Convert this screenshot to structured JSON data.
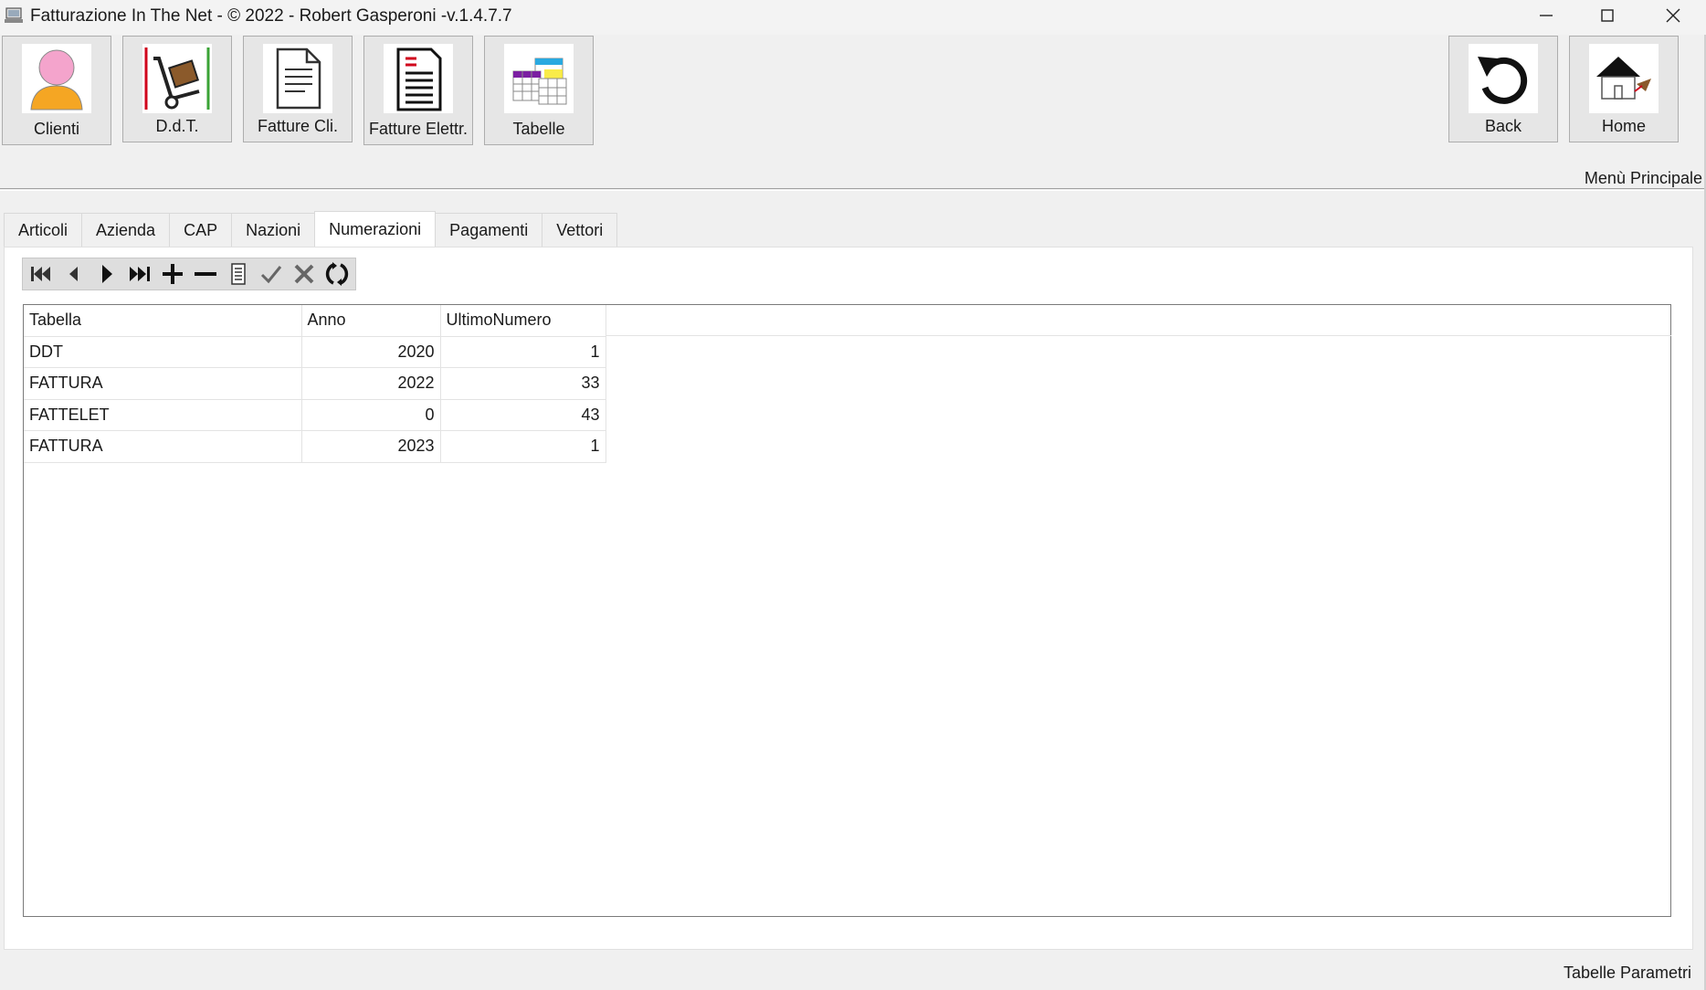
{
  "window": {
    "title": "Fatturazione In The Net - © 2022 - Robert Gasperoni -v.1.4.7.7"
  },
  "toolbar": {
    "left_buttons": [
      {
        "label": "Clienti",
        "icon": "person-icon"
      },
      {
        "label": "D.d.T.",
        "icon": "hand-truck-icon"
      },
      {
        "label": "Fatture Cli.",
        "icon": "document-icon"
      },
      {
        "label": "Fatture Elettr.",
        "icon": "electronic-invoice-icon"
      },
      {
        "label": "Tabelle",
        "icon": "tables-icon"
      }
    ],
    "right_buttons": [
      {
        "label": "Back",
        "icon": "back-arrow-icon"
      },
      {
        "label": "Home",
        "icon": "home-icon"
      }
    ]
  },
  "menu_label": "Menù Principale",
  "tabs": [
    "Articoli",
    "Azienda",
    "CAP",
    "Nazioni",
    "Numerazioni",
    "Pagamenti",
    "Vettori"
  ],
  "active_tab": "Numerazioni",
  "navigator": {
    "buttons": [
      "first-record-icon",
      "prior-record-icon",
      "next-record-icon",
      "last-record-icon",
      "insert-icon",
      "delete-icon",
      "edit-icon",
      "post-icon",
      "cancel-icon",
      "refresh-icon"
    ]
  },
  "grid": {
    "columns": [
      "Tabella",
      "Anno",
      "UltimoNumero"
    ],
    "rows": [
      {
        "tabella": "DDT",
        "anno": "2020",
        "ultimo": "1"
      },
      {
        "tabella": "FATTURA",
        "anno": "2022",
        "ultimo": "33"
      },
      {
        "tabella": "FATTELET",
        "anno": "0",
        "ultimo": "43"
      },
      {
        "tabella": "FATTURA",
        "anno": "2023",
        "ultimo": "1"
      }
    ]
  },
  "status_text": "Tabelle Parametri"
}
